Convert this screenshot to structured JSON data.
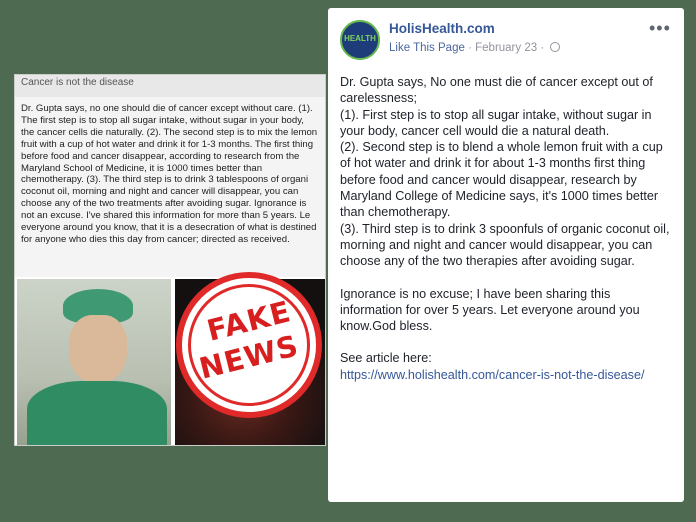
{
  "left_screenshot": {
    "header_text": "Cancer is not the disease",
    "body_text": "Dr. Gupta says, no one should die of cancer except without care. (1). The first step is to stop all sugar intake, without sugar in your body, the cancer cells die naturally. (2). The second step is to mix the lemon fruit with a cup of hot water and drink it for 1-3 months. The first thing before food and cancer disappear, according to research from the Maryland School of Medicine, it is 1000 times better than chemotherapy. (3). The third step is to drink 3 tablespoons of organi coconut oil, morning and night and cancer will disappear, you can choose any of the two treatments after avoiding sugar. Ignorance is not an excuse. I've shared this information for more than 5 years. Le everyone around you know, that it is a desecration of what is destined for anyone who dies this day from cancer; directed as received."
  },
  "stamp": {
    "line1": "FAKE",
    "line2": "NEWS",
    "color": "#d81f1f"
  },
  "post": {
    "avatar_text": "HEALTH",
    "page_name": "HolisHealth.com",
    "like_label": "Like This Page",
    "separator": "·",
    "date": "February 23",
    "separator2": "·",
    "more_label": "•••",
    "paragraphs": {
      "p1": "Dr. Gupta says, No one must die of cancer except out of carelessness;",
      "p2": "(1). First step is to stop all sugar intake, without sugar in your body, cancer cell would die a natural death.",
      "p3": "(2). Second step is to blend a whole lemon fruit with a cup of hot water and drink it for about 1-3 months first thing before food and cancer would disappear, research by Maryland College of Medicine says, it's 1000 times better than chemotherapy.",
      "p4": "(3). Third step is to drink 3 spoonfuls of organic coconut oil, morning and night and cancer would disappear, you can choose any of the two therapies after avoiding sugar.",
      "p5": "Ignorance is no excuse; I have been sharing this information for over 5 years. Let everyone around you know.God bless.",
      "p6": "See article here:",
      "link": "https://www.holishealth.com/cancer-is-not-the-disease/"
    },
    "link_color": "#365899"
  }
}
